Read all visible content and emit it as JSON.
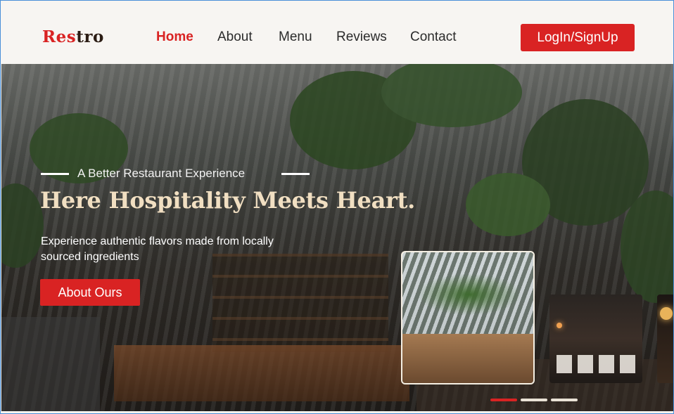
{
  "brand": {
    "logo_red": "Res",
    "logo_dark": "tro",
    "accent_color": "#d92323",
    "dark_color": "#2b1c14"
  },
  "nav": {
    "items": [
      "Home",
      "About",
      "Menu",
      "Reviews",
      "Contact"
    ],
    "active": "Home"
  },
  "header": {
    "login_label": "LogIn/SignUp"
  },
  "hero": {
    "tagline": "A Better Restaurant Experience",
    "headline": "Here Hospitality Meets Heart.",
    "description": "Experience authentic flavors made from locally sourced ingredients",
    "cta_label": "About Ours",
    "headline_color": "#f1dfc2"
  },
  "carousel": {
    "slide_count": 3,
    "active_index": 0
  }
}
